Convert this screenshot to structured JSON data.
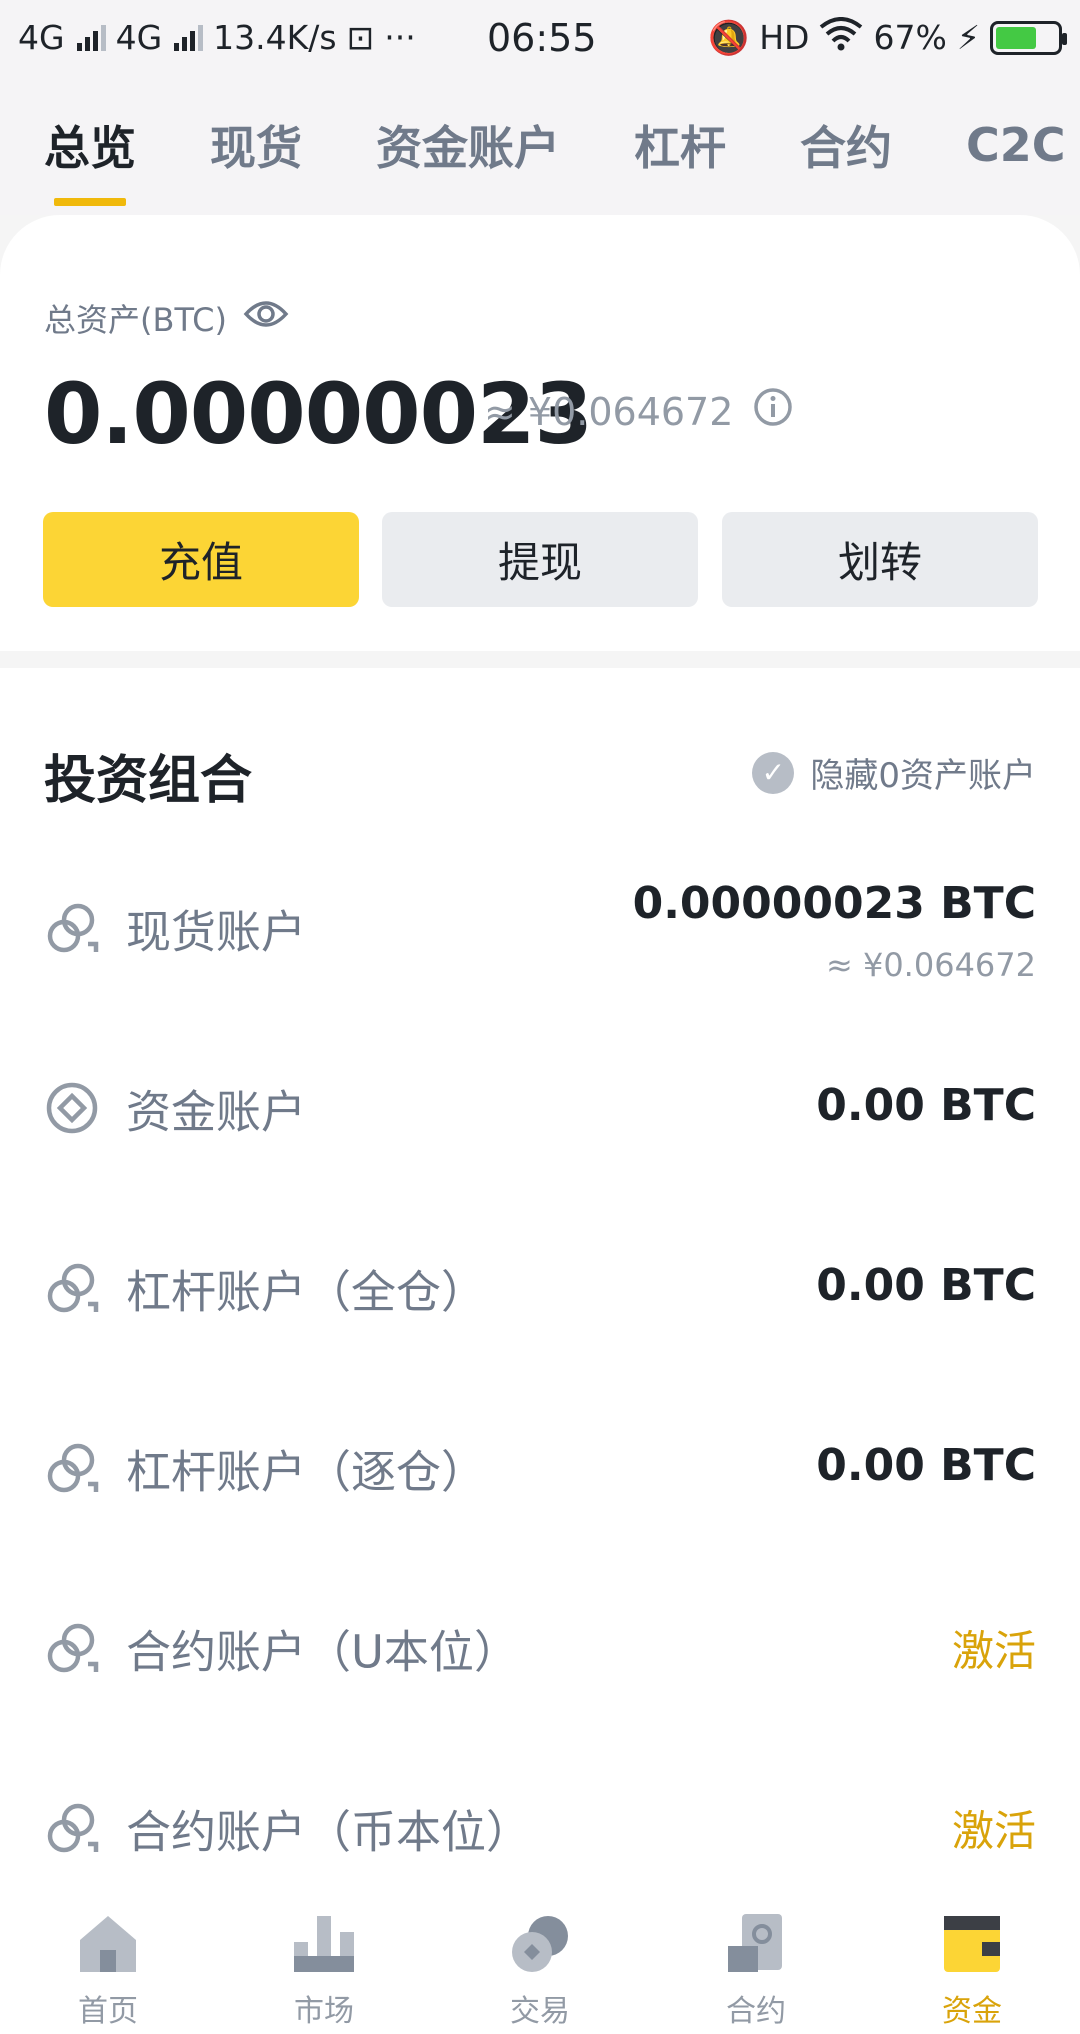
{
  "status": {
    "net1": "4G",
    "net2": "4G",
    "speed": "13.4K/s",
    "time": "06:55",
    "hd": "HD",
    "battery": "67%",
    "battery_level": 67
  },
  "tabs": [
    {
      "label": "总览"
    },
    {
      "label": "现货"
    },
    {
      "label": "资金账户"
    },
    {
      "label": "杠杆"
    },
    {
      "label": "合约"
    },
    {
      "label": "C2C"
    }
  ],
  "overview": {
    "total_label": "总资产(BTC)",
    "total_value": "0.00000023",
    "approx": "≈ ¥0.064672",
    "deposit": "充值",
    "withdraw": "提现",
    "transfer": "划转"
  },
  "portfolio": {
    "title": "投资组合",
    "hide_zero": "隐藏0资产账户",
    "accounts": [
      {
        "name": "现货账户",
        "value": "0.00000023 BTC",
        "sub": "≈ ¥0.064672",
        "icon": "coins-icon"
      },
      {
        "name": "资金账户",
        "value": "0.00 BTC",
        "icon": "funding-icon"
      },
      {
        "name": "杠杆账户（全仓）",
        "value": "0.00 BTC",
        "icon": "coins-icon"
      },
      {
        "name": "杠杆账户（逐仓）",
        "value": "0.00 BTC",
        "icon": "coins-icon"
      },
      {
        "name": "合约账户（U本位）",
        "action": "激活",
        "icon": "coins-icon"
      },
      {
        "name": "合约账户（币本位）",
        "action": "激活",
        "icon": "coins-icon"
      }
    ]
  },
  "nav": [
    {
      "label": "首页",
      "icon": "home-icon"
    },
    {
      "label": "市场",
      "icon": "market-icon"
    },
    {
      "label": "交易",
      "icon": "trade-icon"
    },
    {
      "label": "合约",
      "icon": "futures-icon"
    },
    {
      "label": "资金",
      "icon": "wallet-icon",
      "active": true
    }
  ],
  "colors": {
    "accent": "#FCD535",
    "active_text": "#D9A30A"
  }
}
